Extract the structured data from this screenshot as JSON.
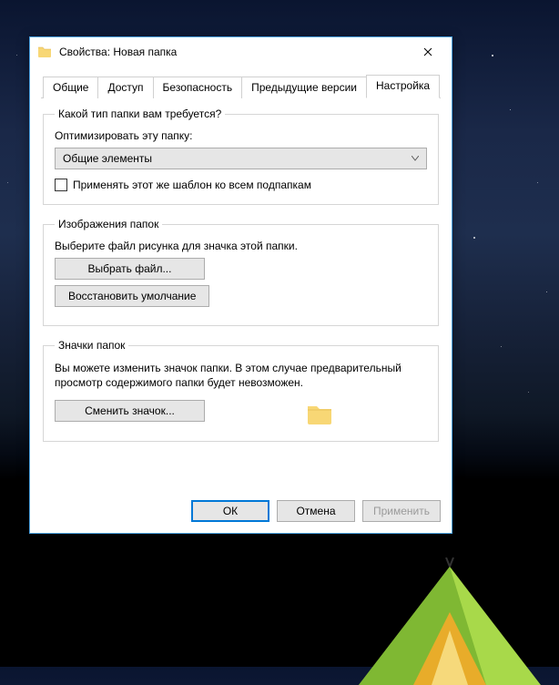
{
  "window": {
    "title": "Свойства: Новая папка"
  },
  "tabs": [
    {
      "label": "Общие"
    },
    {
      "label": "Доступ"
    },
    {
      "label": "Безопасность"
    },
    {
      "label": "Предыдущие версии"
    },
    {
      "label": "Настройка"
    }
  ],
  "folderType": {
    "legend": "Какой тип папки вам требуется?",
    "optimizeLabel": "Оптимизировать эту папку:",
    "comboValue": "Общие элементы",
    "applyCheckbox": "Применять этот же шаблон ко всем подпапкам"
  },
  "folderPictures": {
    "legend": "Изображения папок",
    "hint": "Выберите файл рисунка для значка этой папки.",
    "chooseFile": "Выбрать файл...",
    "restoreDefault": "Восстановить умолчание"
  },
  "folderIcons": {
    "legend": "Значки папок",
    "hint": "Вы можете изменить значок папки. В этом случае предварительный просмотр содержимого папки будет невозможен.",
    "changeIcon": "Сменить значок..."
  },
  "buttons": {
    "ok": "ОК",
    "cancel": "Отмена",
    "apply": "Применить"
  }
}
